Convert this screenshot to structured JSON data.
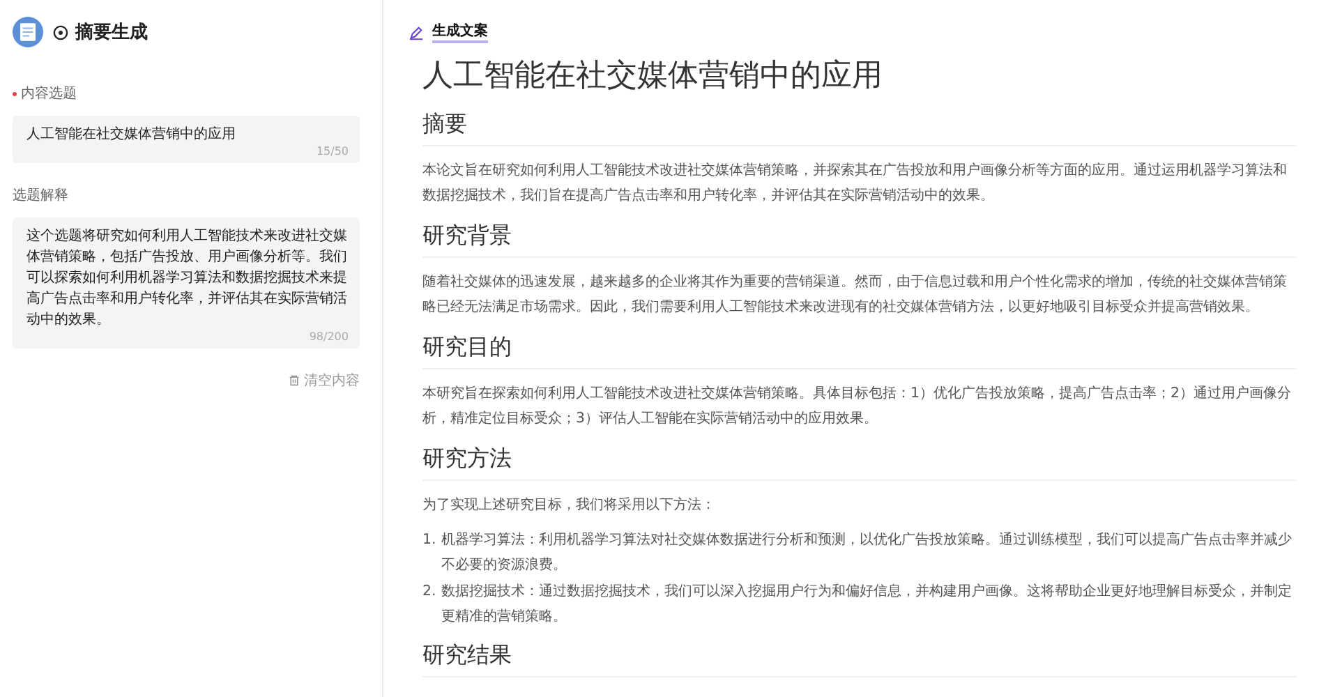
{
  "sidebar": {
    "title": "摘要生成",
    "fields": [
      {
        "label": "内容选题",
        "required": true,
        "value": "人工智能在社交媒体营销中的应用",
        "count": "15/50"
      },
      {
        "label": "选题解释",
        "required": false,
        "value": "这个选题将研究如何利用人工智能技术来改进社交媒体营销策略，包括广告投放、用户画像分析等。我们可以探索如何利用机器学习算法和数据挖掘技术来提高广告点击率和用户转化率，并评估其在实际营销活动中的效果。",
        "count": "98/200"
      }
    ],
    "clear_button": "清空内容"
  },
  "document": {
    "tab": "生成文案",
    "title": "人工智能在社交媒体营销中的应用",
    "sections": [
      {
        "heading": "摘要",
        "blocks": [
          {
            "kind": "paragraph",
            "text": "本论文旨在研究如何利用人工智能技术改进社交媒体营销策略，并探索其在广告投放和用户画像分析等方面的应用。通过运用机器学习算法和数据挖掘技术，我们旨在提高广告点击率和用户转化率，并评估其在实际营销活动中的效果。"
          }
        ]
      },
      {
        "heading": "研究背景",
        "blocks": [
          {
            "kind": "paragraph",
            "text": "随着社交媒体的迅速发展，越来越多的企业将其作为重要的营销渠道。然而，由于信息过载和用户个性化需求的增加，传统的社交媒体营销策略已经无法满足市场需求。因此，我们需要利用人工智能技术来改进现有的社交媒体营销方法，以更好地吸引目标受众并提高营销效果。"
          }
        ]
      },
      {
        "heading": "研究目的",
        "blocks": [
          {
            "kind": "paragraph",
            "text": "本研究旨在探索如何利用人工智能技术改进社交媒体营销策略。具体目标包括：1）优化广告投放策略，提高广告点击率；2）通过用户画像分析，精准定位目标受众；3）评估人工智能在实际营销活动中的应用效果。"
          }
        ]
      },
      {
        "heading": "研究方法",
        "blocks": [
          {
            "kind": "paragraph",
            "text": "为了实现上述研究目标，我们将采用以下方法："
          },
          {
            "kind": "list",
            "items": [
              {
                "marker": "1.",
                "text": "机器学习算法：利用机器学习算法对社交媒体数据进行分析和预测，以优化广告投放策略。通过训练模型，我们可以提高广告点击率并减少不必要的资源浪费。"
              },
              {
                "marker": "2.",
                "text": "数据挖掘技术：通过数据挖掘技术，我们可以深入挖掘用户行为和偏好信息，并构建用户画像。这将帮助企业更好地理解目标受众，并制定更精准的营销策略。"
              }
            ]
          }
        ]
      },
      {
        "heading": "研究结果"
      }
    ]
  }
}
